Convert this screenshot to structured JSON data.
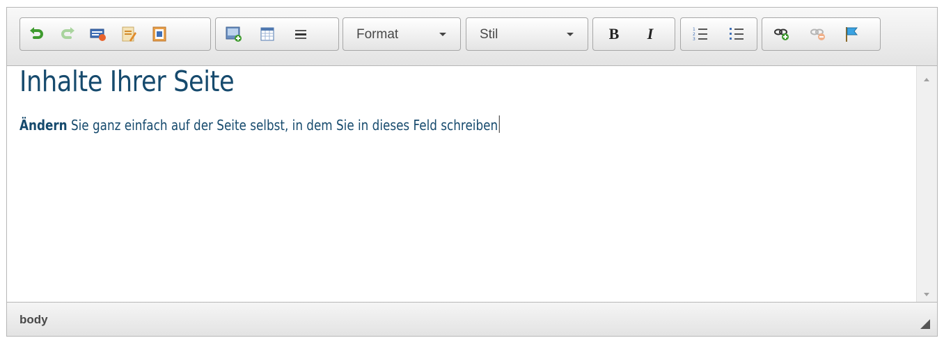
{
  "toolbar": {
    "history": [
      {
        "name": "undo-icon"
      },
      {
        "name": "redo-icon"
      }
    ],
    "clipboard": [
      {
        "name": "html-paste-icon"
      },
      {
        "name": "paste-text-icon"
      },
      {
        "name": "paste-word-icon"
      }
    ],
    "insert": [
      {
        "name": "insert-image-icon"
      },
      {
        "name": "insert-table-icon"
      },
      {
        "name": "horizontal-line-icon"
      }
    ],
    "format_label": "Format",
    "style_label": "Stil",
    "bold_label": "B",
    "italic_label": "I",
    "lists": [
      {
        "name": "numbered-list-icon"
      },
      {
        "name": "bulleted-list-icon"
      }
    ],
    "links": [
      {
        "name": "link-icon"
      },
      {
        "name": "unlink-icon"
      },
      {
        "name": "anchor-flag-icon"
      }
    ]
  },
  "content": {
    "heading": "Inhalte Ihrer Seite",
    "paragraph_bold": "Ändern",
    "paragraph_text": " Sie ganz einfach auf der Seite selbst, in dem Sie in dieses Feld schreiben"
  },
  "status": {
    "path": "body"
  },
  "colors": {
    "text": "#164a6d",
    "toolbar_bg": "#e8e8e8",
    "border": "#b6b6b6"
  }
}
